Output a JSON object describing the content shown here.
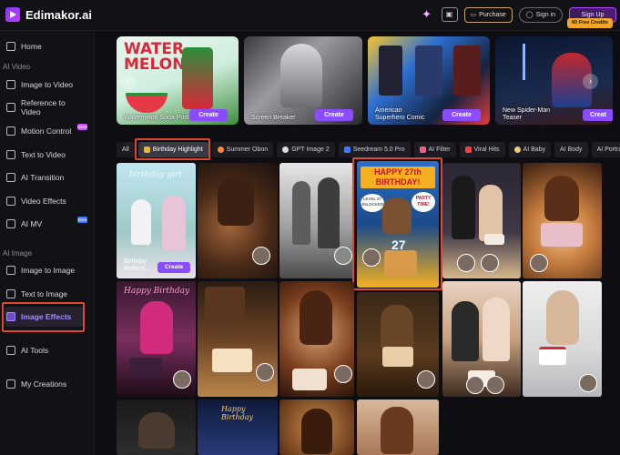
{
  "app": {
    "name": "Edimakor.ai"
  },
  "header": {
    "purchase_label": "Purchase",
    "signin_label": "Sign in",
    "signup_label": "Sign Up",
    "credits_label": "60 Free Credits"
  },
  "sidebar": {
    "home": "Home",
    "section_video": "AI Video",
    "video_items": [
      "Image to Video",
      "Reference to Video",
      "Motion Control",
      "Text to Video",
      "AI Transition",
      "Video Effects",
      "AI MV"
    ],
    "section_image": "AI Image",
    "image_items": [
      "Image to Image",
      "Text to Image",
      "Image Effects"
    ],
    "ai_tools": "AI Tools",
    "my_creations": "My Creations",
    "badge_new": "NEW",
    "badge_beta": "Beta"
  },
  "carousel": {
    "cards": [
      {
        "title": "Watermelon Soda Poster",
        "create": "Create",
        "text": "WATER MELON"
      },
      {
        "title": "Screen Breaker",
        "create": "Create"
      },
      {
        "title": "American Superhero Comic",
        "create": "Create"
      },
      {
        "title": "New Spider-Man Teaser",
        "create": "Creat"
      }
    ]
  },
  "tabs": [
    "All",
    "Birthday Highlight",
    "Summer Obon",
    "GPT Image 2",
    "Seedream 5.0 Pro",
    "AI Filter",
    "Viral Hits",
    "AI Baby",
    "AI Body",
    "AI Portrait"
  ],
  "grid": {
    "first_tile_title": "Birthday Reflecti...",
    "first_tile_create": "Create",
    "tile1_text": "birthday girl",
    "tile3_poster_text": "HAPPY 27th BIRTHDAY!",
    "tile3_cake_number": "27",
    "tile3_bubble_left": "LEVEL 27 UNLOCKED!",
    "tile3_bubble_right": "PARTY TIME!",
    "happy_birthday": "Happy Birthday"
  },
  "colors": {
    "accent": "#8b4bff",
    "highlight_box": "#e0472f",
    "gold": "#f0a52b"
  }
}
